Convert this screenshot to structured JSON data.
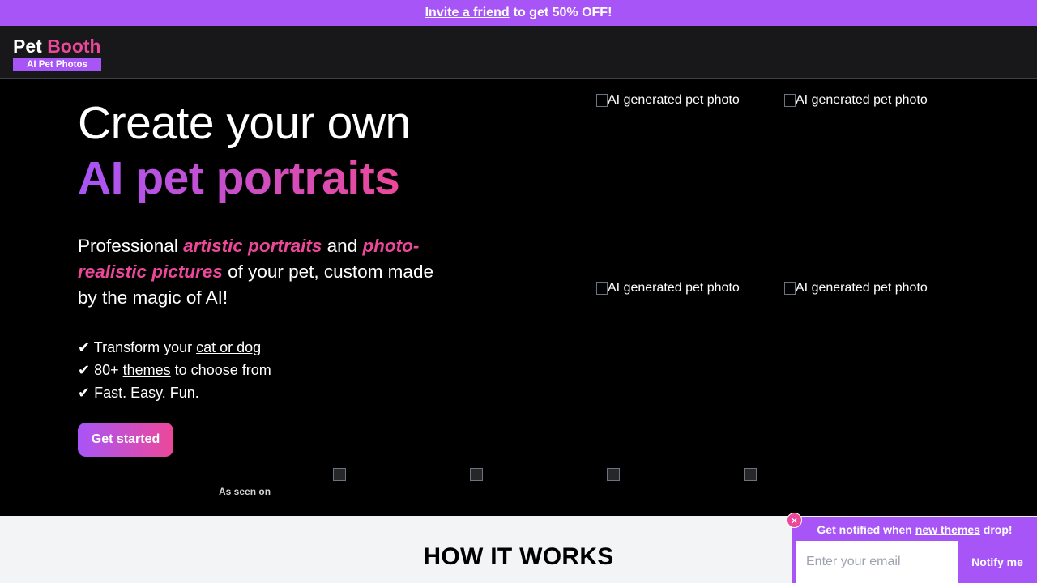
{
  "promo": {
    "link_text": "Invite a friend",
    "rest_text": "to get 50% OFF!"
  },
  "logo": {
    "title_part1": "Pet",
    "title_part2": "Booth",
    "subtitle": "AI Pet Photos"
  },
  "hero": {
    "title_line1": "Create your own",
    "title_line2": "AI pet portraits",
    "desc_part1": "Professional ",
    "desc_accent1": "artistic portraits",
    "desc_part2": " and ",
    "desc_accent2": "photo-realistic pictures",
    "desc_part3": " of your pet, custom made by the magic of AI!",
    "features": [
      {
        "check": "✔",
        "prefix": " Transform your ",
        "link": "cat or dog",
        "suffix": ""
      },
      {
        "check": "✔",
        "prefix": " 80+ ",
        "link": "themes",
        "suffix": " to choose from"
      },
      {
        "check": "✔",
        "prefix": " Fast. Easy. Fun.",
        "link": "",
        "suffix": ""
      }
    ],
    "cta_label": "Get started",
    "as_seen_on": "As seen on"
  },
  "gallery": {
    "alt_text": "AI generated pet photo"
  },
  "how_it_works": {
    "title": "HOW IT WORKS"
  },
  "notify": {
    "text_prefix": "Get notified when ",
    "text_link": "new themes",
    "text_suffix": " drop!",
    "input_placeholder": "Enter your email",
    "button_label": "Notify me",
    "close_symbol": "×"
  },
  "colors": {
    "accent_purple": "#a855f7",
    "accent_pink": "#ec4899",
    "background": "#000000",
    "navbar": "#18181b"
  }
}
